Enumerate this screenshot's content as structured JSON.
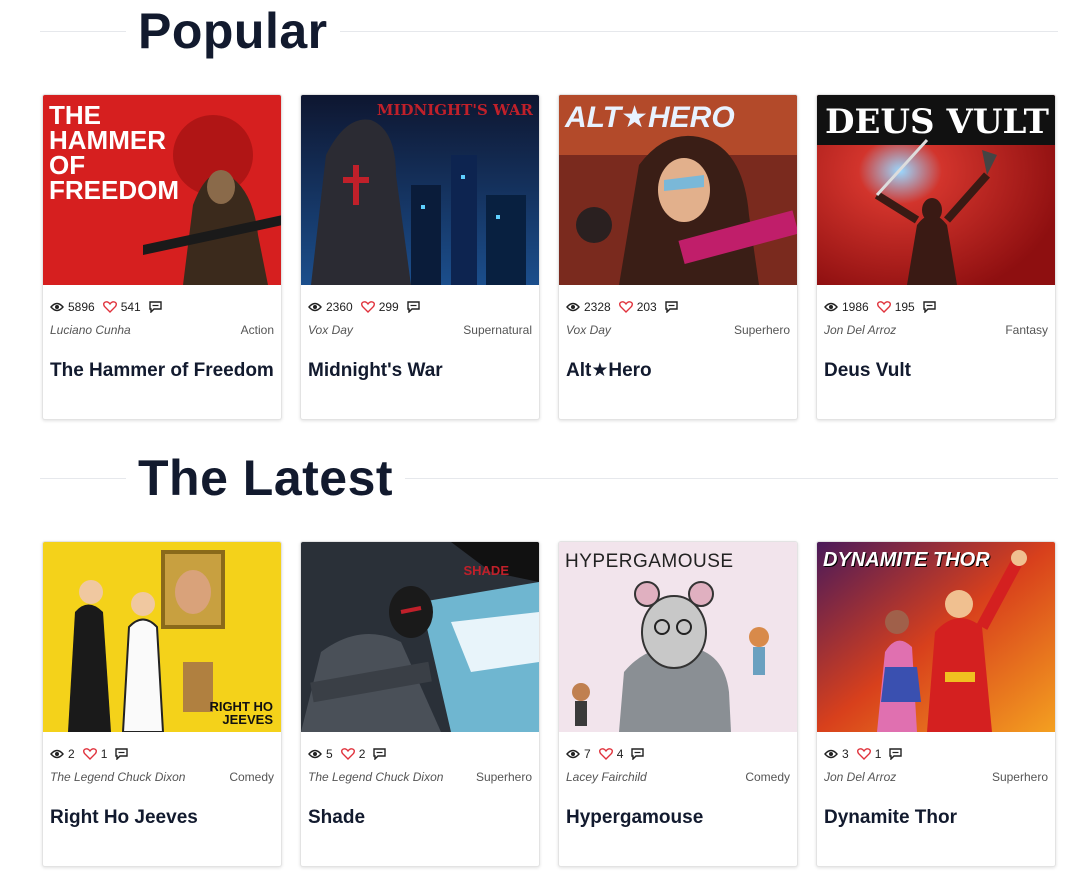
{
  "sections": [
    {
      "heading": "Popular",
      "cards": [
        {
          "views": "5896",
          "likes": "541",
          "author": "Luciano Cunha",
          "genre": "Action",
          "title": "The Hammer of Freedom",
          "cover_text": "THE HAMMER OF FREEDOM"
        },
        {
          "views": "2360",
          "likes": "299",
          "author": "Vox Day",
          "genre": "Supernatural",
          "title": "Midnight's War",
          "cover_text": "MIDNIGHT'S WAR"
        },
        {
          "views": "2328",
          "likes": "203",
          "author": "Vox Day",
          "genre": "Superhero",
          "title": "Alt★Hero",
          "cover_text": "ALT★HERO"
        },
        {
          "views": "1986",
          "likes": "195",
          "author": "Jon Del Arroz",
          "genre": "Fantasy",
          "title": "Deus Vult",
          "cover_text": "DEUS VULT"
        }
      ]
    },
    {
      "heading": "The Latest",
      "cards": [
        {
          "views": "2",
          "likes": "1",
          "author": "The Legend Chuck Dixon",
          "genre": "Comedy",
          "title": "Right Ho Jeeves",
          "cover_text": "RIGHT HO JEEVES"
        },
        {
          "views": "5",
          "likes": "2",
          "author": "The Legend Chuck Dixon",
          "genre": "Superhero",
          "title": "Shade",
          "cover_text": "SHADE"
        },
        {
          "views": "7",
          "likes": "4",
          "author": "Lacey Fairchild",
          "genre": "Comedy",
          "title": "Hypergamouse",
          "cover_text": "HYPERGAMOUSE"
        },
        {
          "views": "3",
          "likes": "1",
          "author": "Jon Del Arroz",
          "genre": "Superhero",
          "title": "Dynamite Thor",
          "cover_text": "DYNAMITE THOR"
        }
      ]
    }
  ],
  "icons": {
    "views": "eye-icon",
    "likes": "heart-icon",
    "comments": "comment-icon"
  },
  "colors": {
    "heading": "#121a2e",
    "heart": "#e0323c",
    "rule": "#e6e8ec"
  }
}
